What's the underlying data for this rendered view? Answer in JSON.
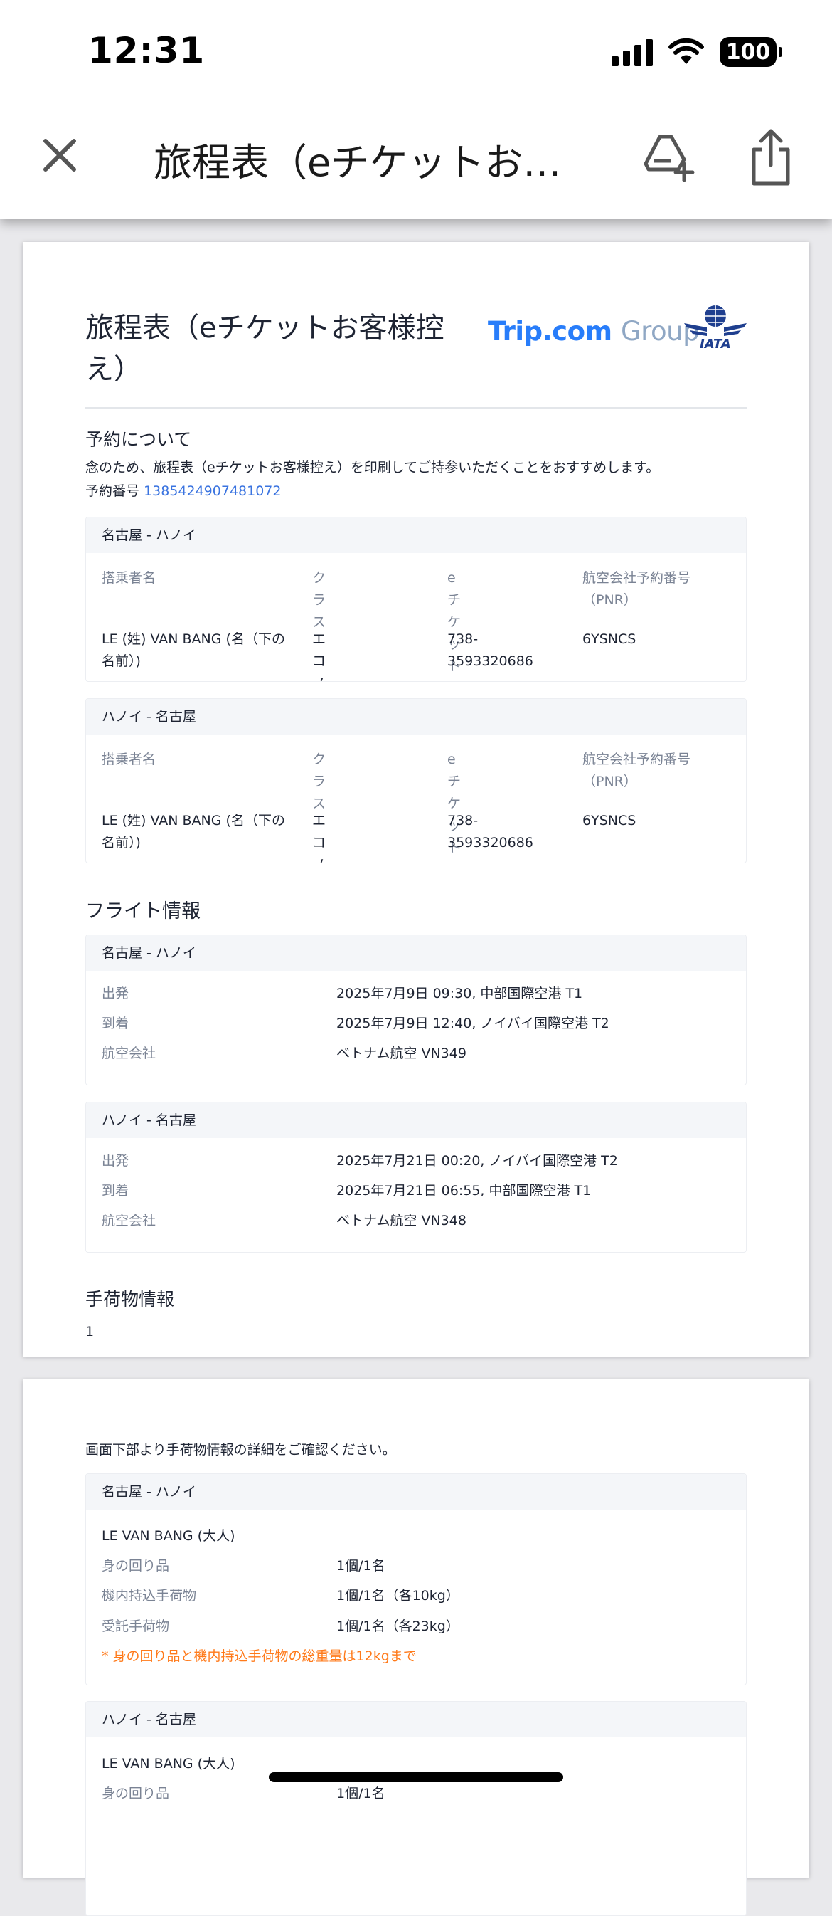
{
  "status_bar": {
    "time": "12:31",
    "battery": "100"
  },
  "nav": {
    "title": "旅程表（eチケットお…"
  },
  "document": {
    "title": "旅程表（eチケットお客様控え）",
    "brand_trip": "Trip.com",
    "brand_group": "Group",
    "reservation": {
      "heading": "予約について",
      "notice": "念のため、旅程表（eチケットお客様控え）を印刷してご持参いただくことをおすすめします。",
      "number_label": "予約番号",
      "number": "1385424907481072"
    },
    "passenger_headers": [
      "搭乗者名",
      "クラス",
      "eチケット番号",
      "航空会社予約番号（PNR）"
    ],
    "tickets": [
      {
        "route": "名古屋 - ハノイ",
        "name": "LE (姓) VAN BANG (名（下の名前）)",
        "class": "エコノミー",
        "eticket": "738-3593320686",
        "pnr": "6YSNCS"
      },
      {
        "route": "ハノイ - 名古屋",
        "name": "LE (姓) VAN BANG (名（下の名前）)",
        "class": "エコノミー",
        "eticket": "738-3593320686",
        "pnr": "6YSNCS"
      }
    ],
    "flight_info": {
      "heading": "フライト情報",
      "labels": {
        "departure": "出発",
        "arrival": "到着",
        "airline": "航空会社"
      },
      "flights": [
        {
          "route": "名古屋 - ハノイ",
          "departure": "2025年7月9日 09:30, 中部国際空港 T1",
          "arrival": "2025年7月9日 12:40, ノイバイ国際空港 T2",
          "airline": "ベトナム航空 VN349"
        },
        {
          "route": "ハノイ - 名古屋",
          "departure": "2025年7月21日 00:20, ノイバイ国際空港 T2",
          "arrival": "2025年7月21日 06:55, 中部国際空港 T1",
          "airline": "ベトナム航空 VN348"
        }
      ]
    },
    "baggage": {
      "heading": "手荷物情報",
      "page_number": "1",
      "intro": "画面下部より手荷物情報の詳細をご確認ください。",
      "labels": {
        "personal": "身の回り品",
        "carry_on": "機内持込手荷物",
        "checked": "受託手荷物"
      },
      "segments": [
        {
          "route": "名古屋 - ハノイ",
          "passenger": "LE VAN BANG (大人)",
          "personal": "1個/1名",
          "carry_on": "1個/1名（各10kg）",
          "checked": "1個/1名（各23kg）",
          "note": "* 身の回り品と機内持込手荷物の総重量は12kgまで"
        },
        {
          "route": "ハノイ - 名古屋",
          "passenger": "LE VAN BANG (大人)",
          "personal": "1個/1名"
        }
      ]
    }
  }
}
